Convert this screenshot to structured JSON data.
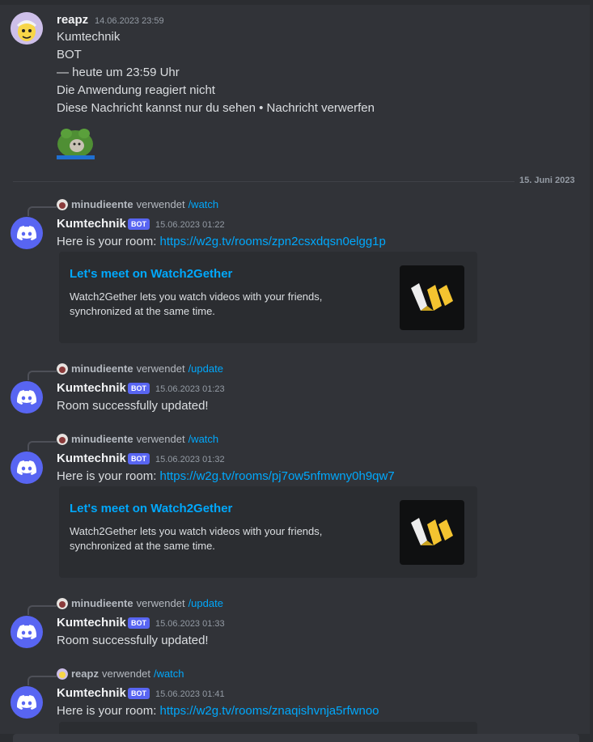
{
  "colors": {
    "background": "#313338",
    "accent": "#5865f2",
    "link": "#00a8fc",
    "username": "#f2f3f5",
    "muted": "#949ba4"
  },
  "first_message": {
    "username": "reapz",
    "timestamp": "14.06.2023 23:59",
    "lines": [
      "Kumtechnik",
      "BOT",
      " — heute um 23:59 Uhr",
      "Die Anwendung reagiert nicht",
      "Diese Nachricht kannst nur du sehen • Nachricht verwerfen"
    ],
    "sticker_icon": "frog-sticker"
  },
  "date_divider": "15. Juni 2023",
  "messages": [
    {
      "reply_user": "minudieente",
      "reply_verb": "verwendet",
      "reply_command": "/watch",
      "bot_name": "Kumtechnik",
      "badge": "BOT",
      "timestamp": "15.06.2023 01:22",
      "text_prefix": "Here is your room: ",
      "link": "https://w2g.tv/rooms/zpn2csxdqsn0elgg1p",
      "embed": {
        "title": "Let's meet on Watch2Gether",
        "description": "Watch2Gether lets you watch videos with your friends, synchronized at the same time.",
        "thumbnail_icon": "watch2gether-logo"
      }
    },
    {
      "reply_user": "minudieente",
      "reply_verb": "verwendet",
      "reply_command": "/update",
      "bot_name": "Kumtechnik",
      "badge": "BOT",
      "timestamp": "15.06.2023 01:23",
      "text": "Room successfully updated!"
    },
    {
      "reply_user": "minudieente",
      "reply_verb": "verwendet",
      "reply_command": "/watch",
      "bot_name": "Kumtechnik",
      "badge": "BOT",
      "timestamp": "15.06.2023 01:32",
      "text_prefix": "Here is your room: ",
      "link": "https://w2g.tv/rooms/pj7ow5nfmwny0h9qw7",
      "embed": {
        "title": "Let's meet on Watch2Gether",
        "description": "Watch2Gether lets you watch videos with your friends, synchronized at the same time.",
        "thumbnail_icon": "watch2gether-logo"
      }
    },
    {
      "reply_user": "minudieente",
      "reply_verb": "verwendet",
      "reply_command": "/update",
      "bot_name": "Kumtechnik",
      "badge": "BOT",
      "timestamp": "15.06.2023 01:33",
      "text": "Room successfully updated!"
    },
    {
      "reply_user": "reapz",
      "reply_verb": "verwendet",
      "reply_command": "/watch",
      "bot_name": "Kumtechnik",
      "badge": "BOT",
      "timestamp": "15.06.2023 01:41",
      "text_prefix": "Here is your room: ",
      "link": "https://w2g.tv/rooms/znaqishvnja5rfwnoo"
    }
  ]
}
